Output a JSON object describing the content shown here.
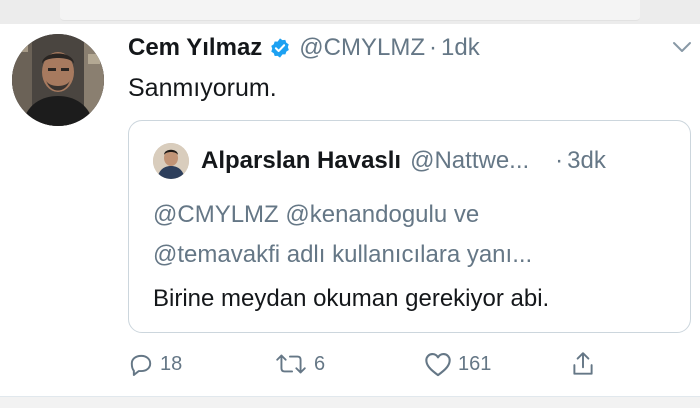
{
  "tweet": {
    "author_name": "Cem Yılmaz",
    "handle": "@CMYLMZ",
    "separator": "·",
    "time": "1dk",
    "text": "Sanmıyorum."
  },
  "quoted": {
    "author_name": "Alparslan Havaslı",
    "handle": "@Nattwe...",
    "separator": "·",
    "time": "3dk",
    "reply_line1": "@CMYLMZ @kenandogulu ve",
    "reply_line2": "@temavakfi adlı kullanıcılara yanı...",
    "text": "Birine meydan okuman gerekiyor abi."
  },
  "actions": {
    "replies": "18",
    "retweets": "6",
    "likes": "161"
  },
  "colors": {
    "verified": "#1da1f2",
    "secondary_text": "#657786",
    "border": "#ccd6dd"
  },
  "icons": [
    "verified-badge-icon",
    "chevron-down-icon",
    "reply-icon",
    "retweet-icon",
    "like-icon",
    "share-icon"
  ]
}
